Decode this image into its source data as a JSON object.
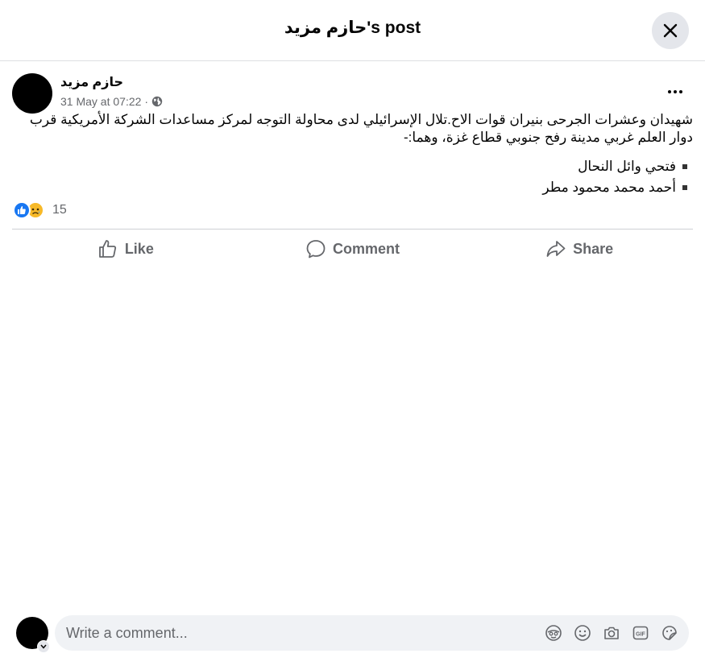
{
  "header": {
    "title": "حازم مزيد's post"
  },
  "post": {
    "author": "حازم مزيد",
    "timestamp": "31 May at 07:22",
    "audience_icon": "globe-icon",
    "text": "شهيدان وعشرات الجرحى بنيران قوات الاح.تلال الإسرائيلي لدى محاولة التوجه لمركز مساعدات الشركة الأمريكية قرب دوار العلم غربي مدينة رفح جنوبي قطاع غزة، وهما:-",
    "names": [
      "فتحي وائل النحال",
      "أحمد محمد محمود مطر"
    ],
    "reaction_icons": [
      "like-icon",
      "sad-icon"
    ],
    "reaction_count": "15"
  },
  "actions": {
    "like": "Like",
    "comment": "Comment",
    "share": "Share"
  },
  "comment_box": {
    "placeholder": "Write a comment...",
    "icons": [
      "avatar-sticker-icon",
      "emoji-icon",
      "camera-icon",
      "gif-icon",
      "sticker-icon"
    ]
  },
  "colors": {
    "accent": "#1877f2",
    "secondary_text": "#65676b",
    "input_bg": "#f0f2f5",
    "sad": "#f7b928"
  }
}
